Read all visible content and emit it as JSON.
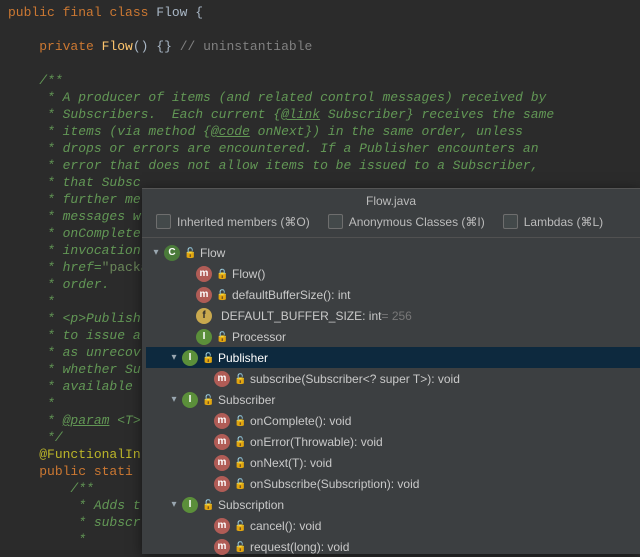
{
  "code": {
    "l1_kw_public": "public",
    "l1_kw_final": "final",
    "l1_kw_class": "class",
    "l1_cls": "Flow",
    "l1_brace": " {",
    "l2_kw": "private",
    "l2_fn": "Flow",
    "l2_paren": "()",
    "l2_body": " {} ",
    "l2_cm": "// uninstantiable",
    "doc_open": "/**",
    "d1": " * A producer of items (and related control messages) received by",
    "d2a": " * Subscribers.  Each current {",
    "d2_link": "@link",
    "d2b": " Subscriber",
    "d2c": "} receives the same",
    "d3a": " * items (via method {",
    "d3_link": "@code",
    "d3b": " onNext}) in the same order, unless",
    "d4": " * drops or errors are encountered. If a Publisher encounters an",
    "d5": " * error that does not allow items to be issued to a Subscriber,",
    "d6": " * that Subsc",
    "d7": " * further me",
    "d8": " * messages w",
    "d9": " * onComplete",
    "d10": " * invocation",
    "d11a": " * href=",
    "d11_str": "\"packa",
    "d12": " * order.",
    "d13": " *",
    "d14": " * <p>Publish",
    "d15": " * to issue a",
    "d16": " * as unrecov",
    "d17": " * whether Su",
    "d18": " * available ",
    "d19": " *",
    "d20a": " * ",
    "d20_tag": "@param",
    "d20b": " <T>",
    "doc_close": " */",
    "ann": "@FunctionalIn",
    "l21a": "public",
    "l21b": " stati",
    "l22": "/**",
    "l23": " * Adds t",
    "l24": " * subscr",
    "l25": " * "
  },
  "popup": {
    "title": "Flow.java",
    "filters": {
      "inherited": "Inherited members (⌘O)",
      "anon": "Anonymous Classes (⌘I)",
      "lambdas": "Lambdas (⌘L)"
    }
  },
  "tree": {
    "flow": "Flow",
    "ctor": "Flow()",
    "dbs": "defaultBufferSize(): int",
    "dbsf_name": "DEFAULT_BUFFER_SIZE: int",
    "dbsf_val": " = 256",
    "proc": "Processor",
    "pub": "Publisher",
    "sub_method": "subscribe(Subscriber<? super T>): void",
    "subscriber": "Subscriber",
    "onComplete": "onComplete(): void",
    "onError": "onError(Throwable): void",
    "onNext": "onNext(T): void",
    "onSubscribe": "onSubscribe(Subscription): void",
    "subscription": "Subscription",
    "cancel": "cancel(): void",
    "request": "request(long): void"
  }
}
